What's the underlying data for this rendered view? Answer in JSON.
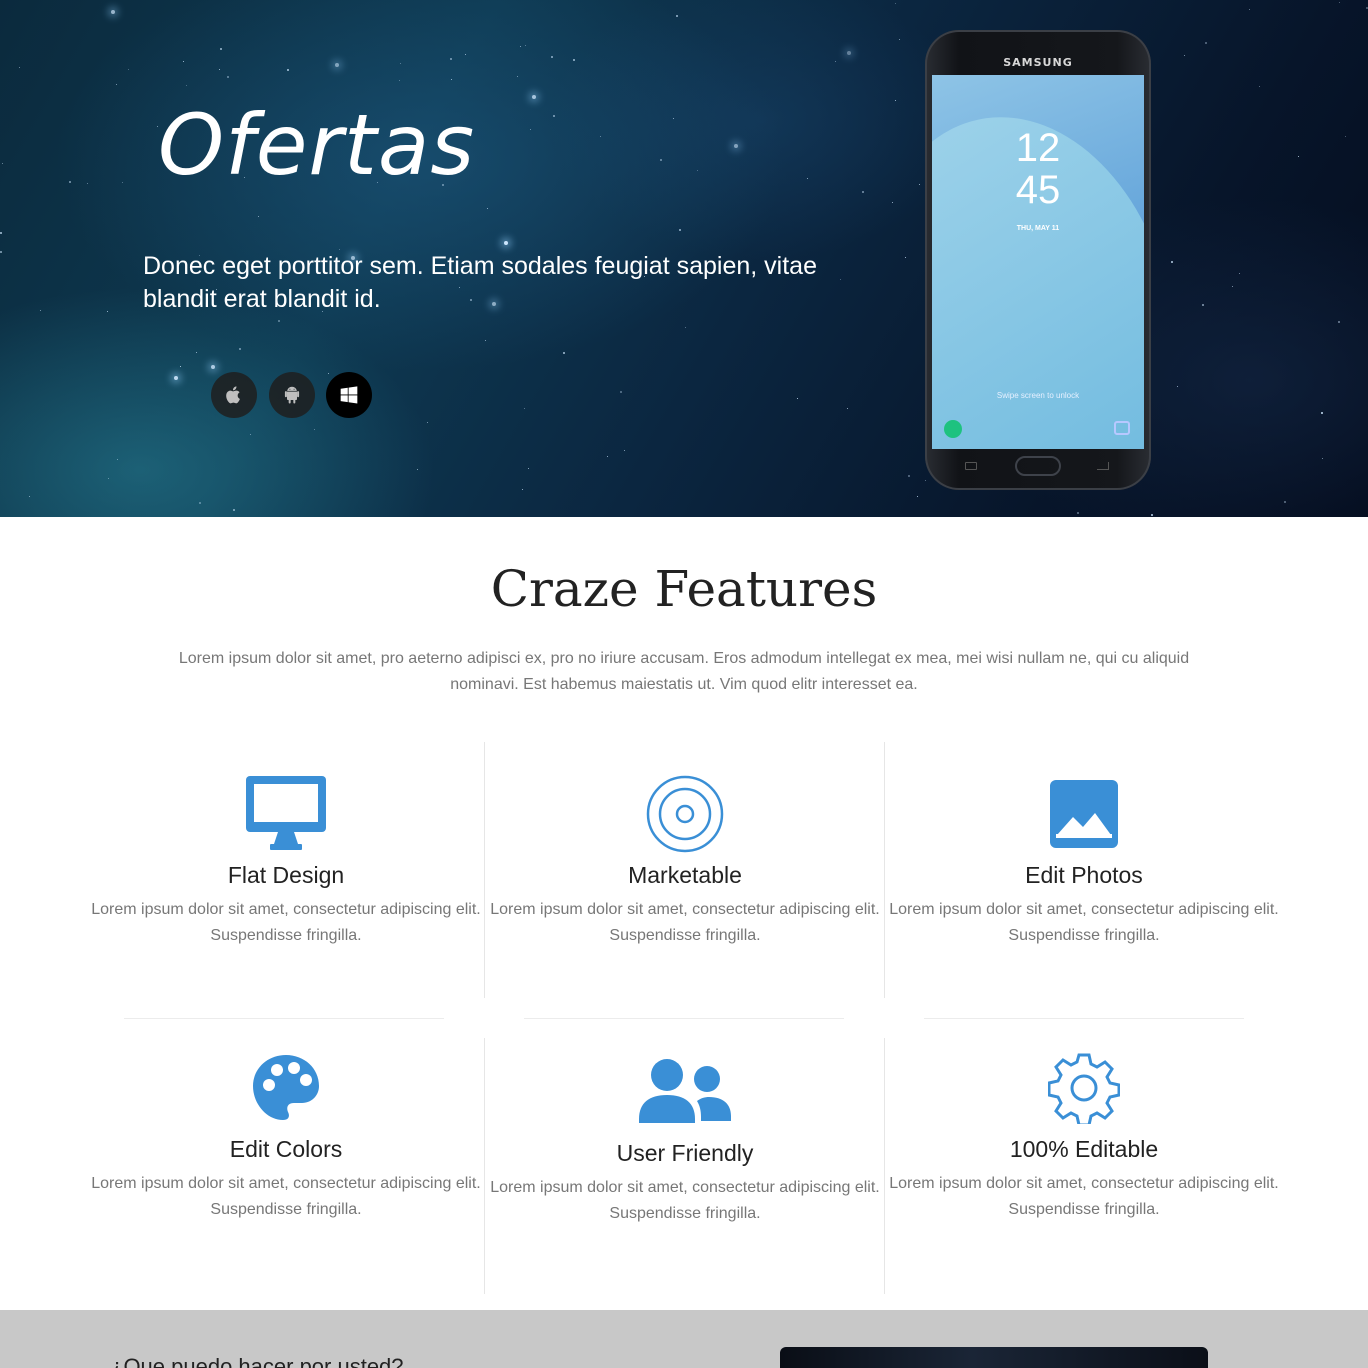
{
  "hero": {
    "title": "Ofertas",
    "subtitle": "Donec eget porttitor sem. Etiam sodales feugiat sapien, vitae blandit erat blandit id.",
    "platforms": [
      {
        "name": "apple",
        "icon": "apple-icon",
        "active": false
      },
      {
        "name": "android",
        "icon": "android-icon",
        "active": false
      },
      {
        "name": "windows",
        "icon": "windows-icon",
        "active": true
      }
    ],
    "phone": {
      "brand": "SAMSUNG",
      "clock_hour": "12",
      "clock_min": "45",
      "date": "THU, MAY 11",
      "swipe_text": "Swipe screen to unlock"
    }
  },
  "features": {
    "title": "Craze Features",
    "description": "Lorem ipsum dolor sit amet, pro aeterno adipisci ex, pro no iriure accusam. Eros admodum intellegat ex mea, mei wisi nullam ne, qui cu aliquid nominavi. Est habemus maiestatis ut. Vim quod elitr interesset ea.",
    "items": [
      {
        "title": "Flat Design",
        "text": "Lorem ipsum dolor sit amet, consectetur adipiscing elit. Suspendisse fringilla.",
        "icon": "monitor-icon"
      },
      {
        "title": "Marketable",
        "text": "Lorem ipsum dolor sit amet, consectetur adipiscing elit. Suspendisse fringilla.",
        "icon": "target-icon"
      },
      {
        "title": "Edit Photos",
        "text": "Lorem ipsum dolor sit amet, consectetur adipiscing elit. Suspendisse fringilla.",
        "icon": "image-icon"
      },
      {
        "title": "Edit Colors",
        "text": "Lorem ipsum dolor sit amet, consectetur adipiscing elit. Suspendisse fringilla.",
        "icon": "palette-icon"
      },
      {
        "title": "User Friendly",
        "text": "Lorem ipsum dolor sit amet, consectetur adipiscing elit. Suspendisse fringilla.",
        "icon": "users-icon"
      },
      {
        "title": "100% Editable",
        "text": "Lorem ipsum dolor sit amet, consectetur adipiscing elit. Suspendisse fringilla.",
        "icon": "gear-icon"
      }
    ]
  },
  "next_section": {
    "question": "¿Que puedo hacer por usted?"
  },
  "colors": {
    "accent": "#3a8fd6",
    "text_dark": "#222222",
    "text_muted": "#777777"
  }
}
